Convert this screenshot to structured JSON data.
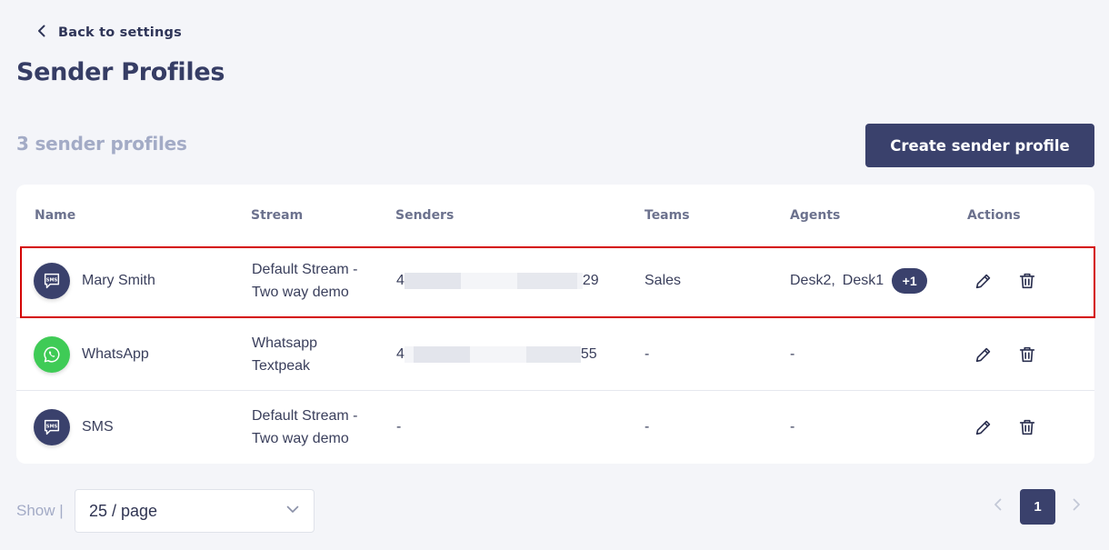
{
  "header": {
    "back_label": "Back to settings",
    "title": "Sender Profiles"
  },
  "toolbar": {
    "count_label": "3 sender profiles",
    "create_label": "Create sender profile"
  },
  "table": {
    "columns": [
      "Name",
      "Stream",
      "Senders",
      "Teams",
      "Agents",
      "Actions"
    ],
    "rows": [
      {
        "icon": "sms-chat-icon",
        "name": "Mary Smith",
        "stream": [
          "Default Stream -",
          "Two way demo"
        ],
        "sender_prefix": "4",
        "sender_suffix": "29",
        "teams": "Sales",
        "agents": [
          "Desk2,",
          "Desk1"
        ],
        "agents_extra": "+1",
        "highlighted": true
      },
      {
        "icon": "whatsapp-icon",
        "name": "WhatsApp",
        "stream": [
          "Whatsapp",
          "Textpeak"
        ],
        "sender_prefix": "4",
        "sender_suffix": "55",
        "teams": "-",
        "agents_text": "-"
      },
      {
        "icon": "sms-chat-icon",
        "name": "SMS",
        "stream": [
          "Default Stream -",
          "Two way demo"
        ],
        "sender_text": "-",
        "teams": "-",
        "agents_text": "-"
      }
    ]
  },
  "footer": {
    "show_label": "Show |",
    "page_size": "25 / page",
    "current_page": "1"
  },
  "colors": {
    "primary": "#3a416c",
    "whatsapp": "#3fcb56",
    "highlight": "#d40000",
    "muted": "#a3abc6"
  }
}
